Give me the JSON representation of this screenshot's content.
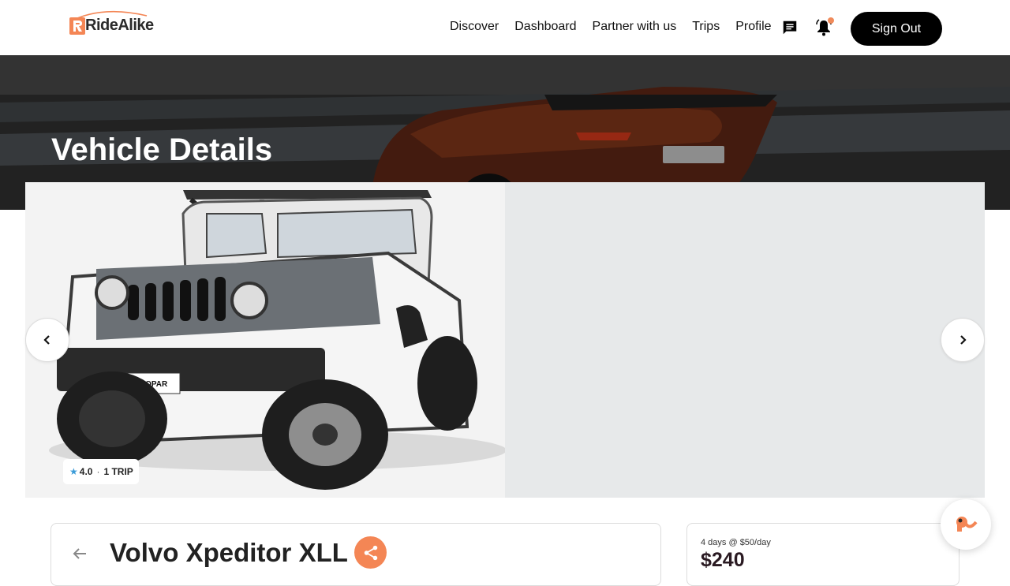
{
  "brand": {
    "name": "RideAlike",
    "accent": "#f48655"
  },
  "nav": {
    "items": [
      {
        "label": "Discover"
      },
      {
        "label": "Dashboard"
      },
      {
        "label": "Partner with us"
      },
      {
        "label": "Trips"
      },
      {
        "label": "Profile"
      }
    ],
    "sign_out_label": "Sign Out"
  },
  "hero": {
    "title": "Vehicle Details"
  },
  "gallery": {
    "rating": "4.0",
    "trips": "1 TRIP"
  },
  "vehicle": {
    "name": "Volvo Xpeditor XLL"
  },
  "pricing": {
    "summary": "4 days @ $50/day",
    "total": "$240"
  },
  "icons": {
    "chat": "message-icon",
    "notifications": "bell-icon",
    "prev": "chevron-left-icon",
    "next": "chevron-right-icon",
    "back": "arrow-left-icon",
    "share": "share-icon",
    "support": "chat-support-icon"
  }
}
